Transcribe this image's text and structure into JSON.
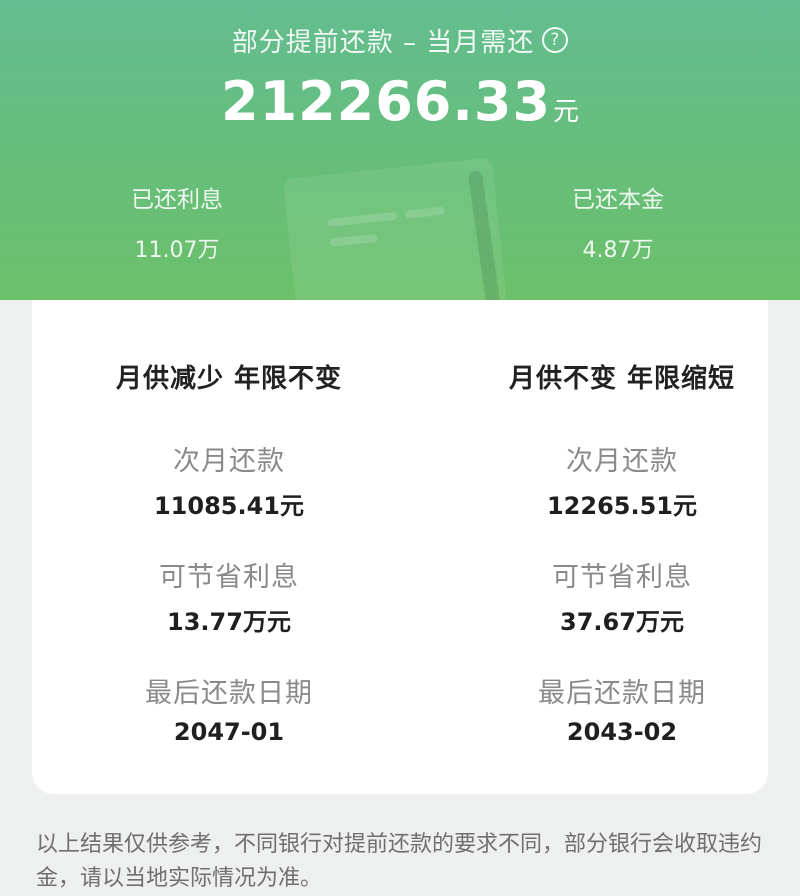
{
  "header": {
    "title": "部分提前还款 – 当月需还",
    "help_icon": "question-circle-icon",
    "amount": "212266.33",
    "amount_unit": "元",
    "paid_interest_label": "已还利息",
    "paid_interest_value": "11.07万",
    "paid_principal_label": "已还本金",
    "paid_principal_value": "4.87万"
  },
  "options": [
    {
      "title": "月供减少 年限不变",
      "next_payment_label": "次月还款",
      "next_payment_value": "11085.41元",
      "interest_saved_label": "可节省利息",
      "interest_saved_value": "13.77万元",
      "last_date_label": "最后还款日期",
      "last_date_value": "2047-01"
    },
    {
      "title": "月供不变 年限缩短",
      "next_payment_label": "次月还款",
      "next_payment_value": "12265.51元",
      "interest_saved_label": "可节省利息",
      "interest_saved_value": "37.67万元",
      "last_date_label": "最后还款日期",
      "last_date_value": "2043-02"
    }
  ],
  "disclaimer": "以上结果仅供参考，不同银行对提前还款的要求不同，部分银行会收取违约金，请以当地实际情况为准。",
  "colors": {
    "header_green": "#66be7a",
    "card": "#ffffff",
    "page_bg": "#eef0ef"
  }
}
